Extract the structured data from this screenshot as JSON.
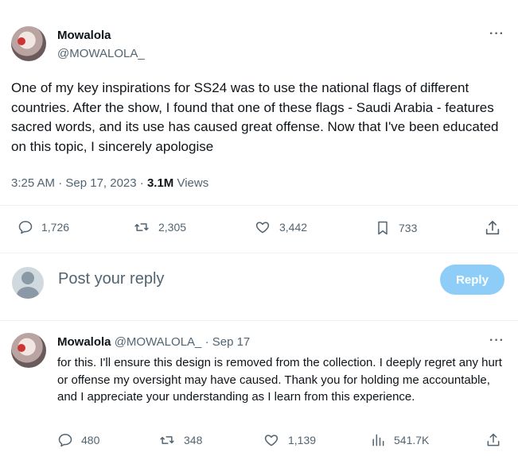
{
  "tweet": {
    "author_name": "Mowalola",
    "author_handle": "@MOWALOLA_",
    "more_icon": "more-horizontal-icon",
    "text": "One of my key inspirations for SS24 was to use the national flags of different countries. After the show, I found that one of these flags - Saudi Arabia - features sacred words, and its use has caused great offense. Now that I've been educated on this topic, I sincerely apologise",
    "time": "3:25 AM · Sep 17, 2023 · ",
    "views_count": "3.1M",
    "views_label": " Views",
    "actions": {
      "replies": "1,726",
      "retweets": "2,305",
      "likes": "3,442",
      "bookmarks": "733"
    }
  },
  "composer": {
    "placeholder": "Post your reply",
    "button_label": "Reply",
    "button_color": "#8ecdf8"
  },
  "reply": {
    "author_name": "Mowalola",
    "author_handle": "@MOWALOLA_",
    "date": "· Sep 17",
    "text": "for this. I'll ensure this design is removed from the collection. I deeply regret any hurt or offense my oversight may have caused. Thank you for holding me accountable, and I appreciate your understanding as I learn from this experience.",
    "actions": {
      "replies": "480",
      "retweets": "348",
      "likes": "1,139",
      "views": "541.7K"
    }
  },
  "colors": {
    "text_primary": "#0f1419",
    "text_secondary": "#536471",
    "divider": "#eff3f4"
  }
}
